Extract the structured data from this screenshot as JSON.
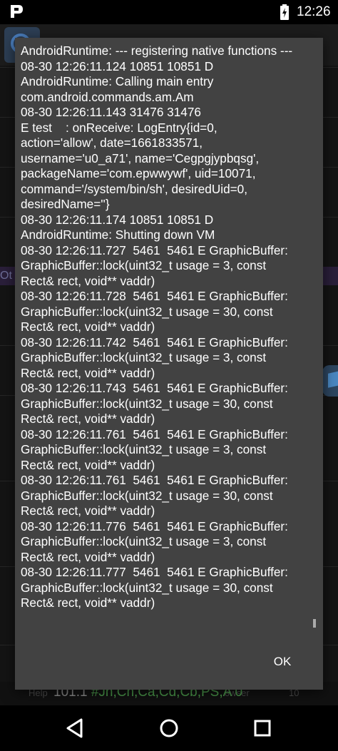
{
  "status_bar": {
    "time": "12:26",
    "app_icon": "p-letter-app-icon",
    "battery_icon": "battery-charging-icon"
  },
  "background_app": {
    "partial_text": "Ot",
    "bottom_bar": {
      "value": "101.1",
      "tags": "#Jh,Ch,Ca,Cd,Cb,PS,A 0",
      "faint_left": "Help",
      "faint_middle": "owser",
      "faint_right": "10"
    }
  },
  "dialog": {
    "message": "AndroidRuntime: --- registering native functions ---\n08-30 12:26:11.124 10851 10851 D\nAndroidRuntime: Calling main entry\ncom.android.commands.am.Am\n08-30 12:26:11.143 31476 31476\nE test    : onReceive: LogEntry{id=0,\naction='allow', date=1661833571,\nusername='u0_a71', name='Cegpgjypbqsg',\npackageName='com.epwwywf', uid=10071,\ncommand='/system/bin/sh', desiredUid=0,\ndesiredName=''}\n08-30 12:26:11.174 10851 10851 D\nAndroidRuntime: Shutting down VM\n08-30 12:26:11.727  5461  5461 E GraphicBuffer:\nGraphicBuffer::lock(uint32_t usage = 3, const\nRect& rect, void** vaddr)\n08-30 12:26:11.728  5461  5461 E GraphicBuffer:\nGraphicBuffer::lock(uint32_t usage = 30, const\nRect& rect, void** vaddr)\n08-30 12:26:11.742  5461  5461 E GraphicBuffer:\nGraphicBuffer::lock(uint32_t usage = 3, const\nRect& rect, void** vaddr)\n08-30 12:26:11.743  5461  5461 E GraphicBuffer:\nGraphicBuffer::lock(uint32_t usage = 30, const\nRect& rect, void** vaddr)\n08-30 12:26:11.761  5461  5461 E GraphicBuffer:\nGraphicBuffer::lock(uint32_t usage = 3, const\nRect& rect, void** vaddr)\n08-30 12:26:11.761  5461  5461 E GraphicBuffer:\nGraphicBuffer::lock(uint32_t usage = 30, const\nRect& rect, void** vaddr)\n08-30 12:26:11.776  5461  5461 E GraphicBuffer:\nGraphicBuffer::lock(uint32_t usage = 3, const\nRect& rect, void** vaddr)\n08-30 12:26:11.777  5461  5461 E GraphicBuffer:\nGraphicBuffer::lock(uint32_t usage = 30, const\nRect& rect, void** vaddr)",
    "ok_label": "OK"
  },
  "nav_bar": {
    "back_icon": "back-triangle-icon",
    "home_icon": "home-circle-icon",
    "recents_icon": "recents-square-icon"
  },
  "colors": {
    "dialog_bg": "#424242",
    "text": "#ffffff",
    "background": "#000000",
    "accent_green": "#4b9a4b"
  }
}
